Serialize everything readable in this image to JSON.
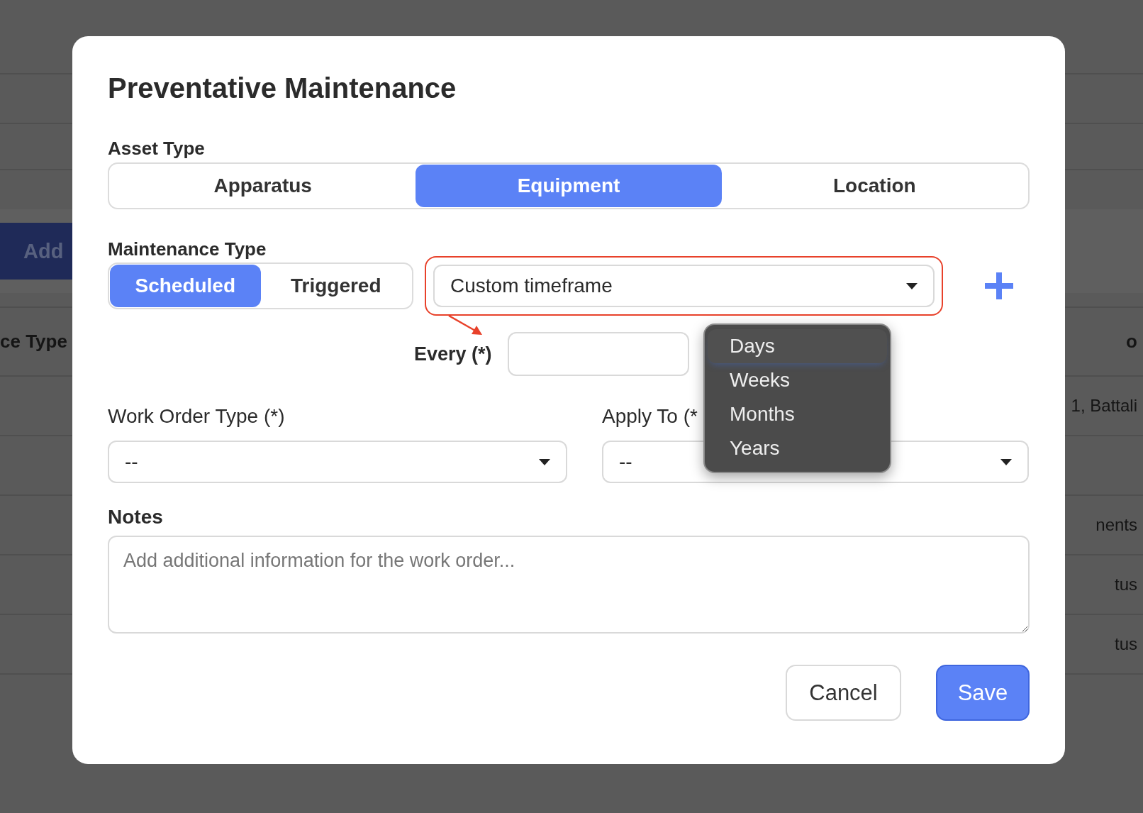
{
  "background": {
    "add_button": "Add",
    "header": {
      "column_1": "ce Type",
      "column_2": "o"
    },
    "rows": [
      {
        "column_2": "1, Battali"
      },
      {},
      {
        "column_2": "nents"
      },
      {
        "column_2": "tus"
      },
      {
        "column_2": "tus"
      }
    ]
  },
  "dialog": {
    "title": "Preventative Maintenance",
    "asset_type": {
      "label": "Asset Type",
      "options": [
        {
          "label": "Apparatus",
          "selected": false
        },
        {
          "label": "Equipment",
          "selected": true
        },
        {
          "label": "Location",
          "selected": false
        }
      ]
    },
    "maintenance_type": {
      "label": "Maintenance Type",
      "options": [
        {
          "label": "Scheduled",
          "selected": true
        },
        {
          "label": "Triggered",
          "selected": false
        }
      ],
      "schedule": {
        "value": "Custom timeframe"
      }
    },
    "every": {
      "label": "Every (*)",
      "unit_menu": [
        {
          "label": "Days",
          "selected": true
        },
        {
          "label": "Weeks",
          "selected": false
        },
        {
          "label": "Months",
          "selected": false
        },
        {
          "label": "Years",
          "selected": false
        }
      ]
    },
    "work_order_type": {
      "label": "Work Order Type (*)",
      "value": "--"
    },
    "apply_to": {
      "label": "Apply To (*",
      "value": "--"
    },
    "notes": {
      "label": "Notes",
      "placeholder": "Add additional information for the work order..."
    },
    "buttons": [
      {
        "label": "Cancel",
        "kind": "secondary"
      },
      {
        "label": "Save",
        "kind": "primary"
      }
    ]
  }
}
